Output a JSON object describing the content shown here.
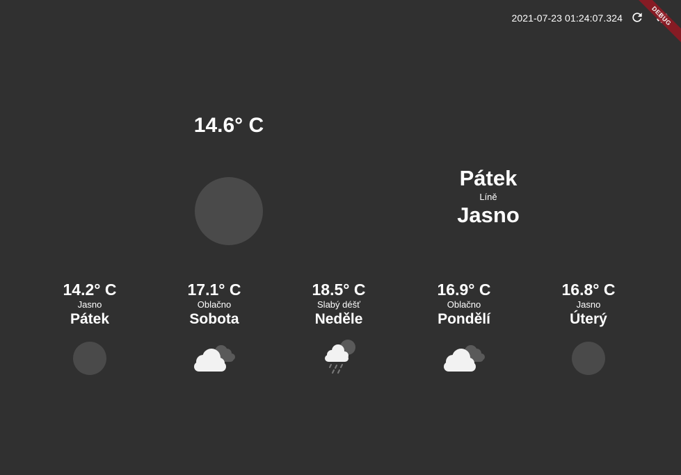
{
  "header": {
    "timestamp": "2021-07-23 01:24:07.324",
    "refresh_icon": "refresh-icon",
    "settings_icon": "gear-icon",
    "debug_banner": "DEBUG"
  },
  "current": {
    "temperature": "14.6° C",
    "icon": "clear-night-icon",
    "day": "Pátek",
    "city": "Líně",
    "description": "Jasno"
  },
  "forecast": [
    {
      "temperature": "14.2° C",
      "description": "Jasno",
      "day": "Pátek",
      "icon": "clear-night-icon"
    },
    {
      "temperature": "17.1° C",
      "description": "Oblačno",
      "day": "Sobota",
      "icon": "cloudy-icon"
    },
    {
      "temperature": "18.5° C",
      "description": "Slabý déšť",
      "day": "Neděle",
      "icon": "light-rain-icon"
    },
    {
      "temperature": "16.9° C",
      "description": "Oblačno",
      "day": "Pondělí",
      "icon": "cloudy-icon"
    },
    {
      "temperature": "16.8° C",
      "description": "Jasno",
      "day": "Úterý",
      "icon": "clear-night-icon"
    }
  ],
  "colors": {
    "background": "#303030",
    "text": "#ffffff",
    "disc": "#4a4a4a",
    "cloud": "#f2f2f2",
    "cloud_back": "#5a5a5a",
    "debug_ribbon": "#8e1a24"
  }
}
